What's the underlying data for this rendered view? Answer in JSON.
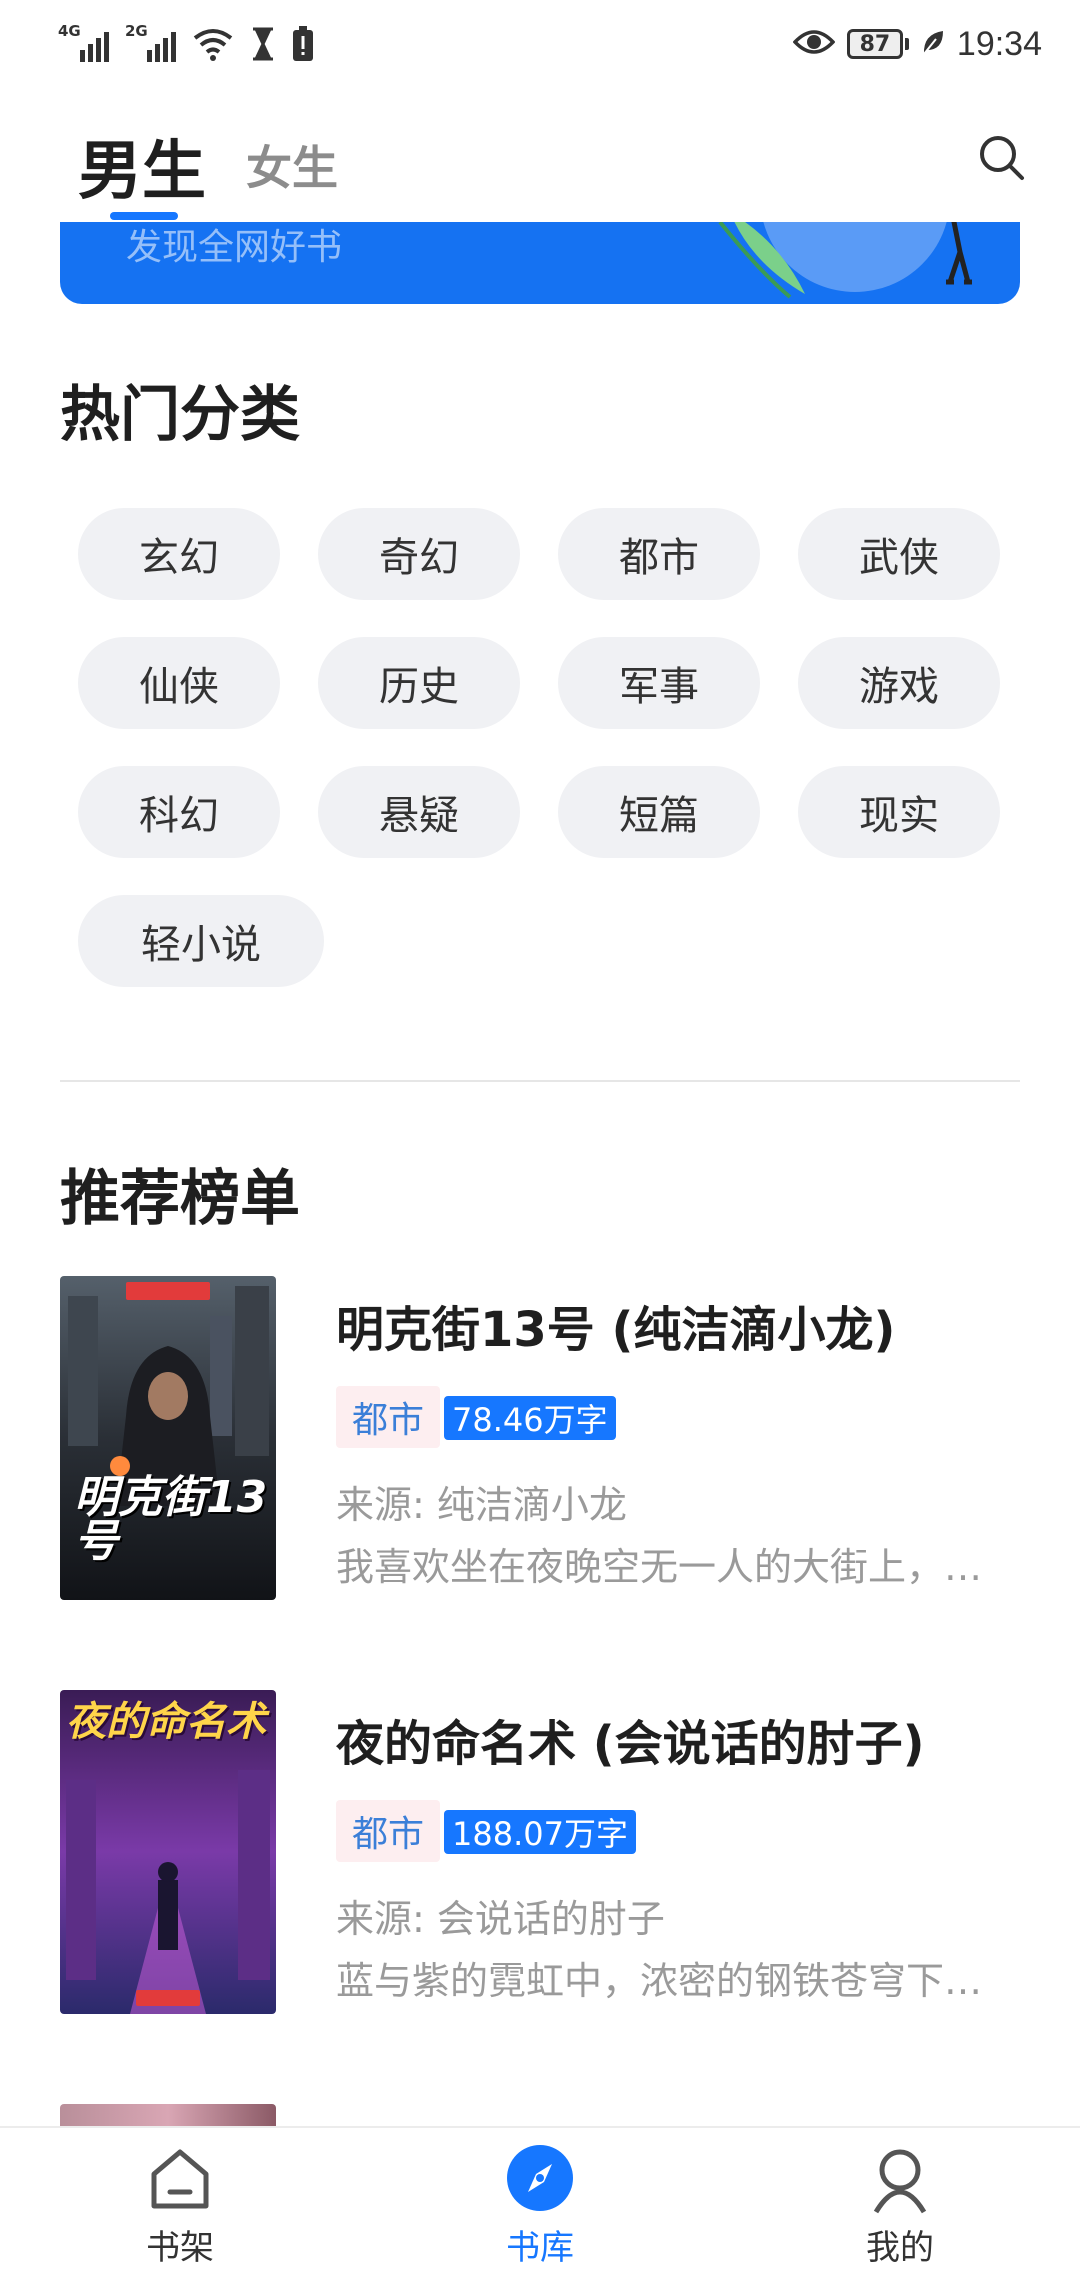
{
  "status_bar": {
    "sim1_network": "4G",
    "sim2_network": "2G",
    "battery_level": "87",
    "time": "19:34",
    "icons": [
      "signal-icon",
      "wifi-icon",
      "hourglass-icon",
      "battery-warning-icon",
      "eye-icon",
      "battery-icon",
      "leaf-icon"
    ]
  },
  "header": {
    "tab_male": "男生",
    "tab_female": "女生",
    "active_tab": "男生",
    "accent_color": "#1677ff"
  },
  "banner": {
    "text": "发现全网好书",
    "color": "#1572f2"
  },
  "categories": {
    "title": "热门分类",
    "items": [
      "玄幻",
      "奇幻",
      "都市",
      "武侠",
      "仙侠",
      "历史",
      "军事",
      "游戏",
      "科幻",
      "悬疑",
      "短篇",
      "现实",
      "轻小说"
    ]
  },
  "recommend": {
    "title": "推荐榜单",
    "books": [
      {
        "title": "明克街13号 (纯洁滴小龙)",
        "category": "都市",
        "word_count": "78.46万字",
        "source": "来源: 纯洁滴小龙",
        "description": "我喜欢坐在夜晚空无一人的大街上，…",
        "cover_title": "明克街13号"
      },
      {
        "title": "夜的命名术 (会说话的肘子)",
        "category": "都市",
        "word_count": "188.07万字",
        "source": "来源: 会说话的肘子",
        "description": "蓝与紫的霓虹中，浓密的钢铁苍穹下…",
        "cover_title": "夜的命名术"
      }
    ]
  },
  "bottom_nav": {
    "items": [
      {
        "label": "书架",
        "icon": "home-icon"
      },
      {
        "label": "书库",
        "icon": "compass-icon"
      },
      {
        "label": "我的",
        "icon": "user-icon"
      }
    ],
    "active": "书库"
  }
}
